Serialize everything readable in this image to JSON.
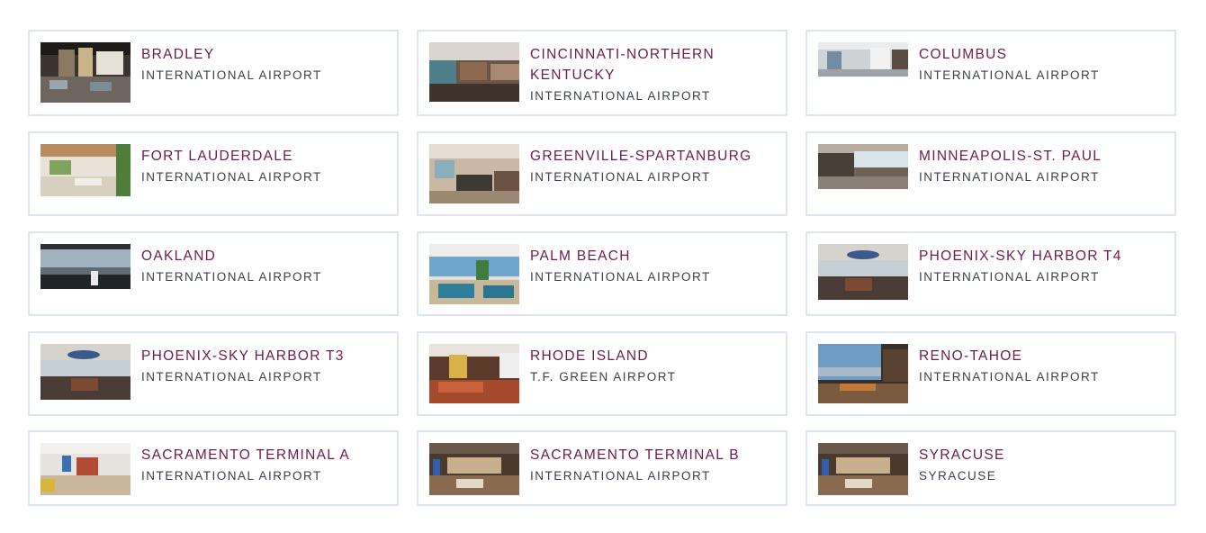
{
  "lounges": [
    {
      "name": "BRADLEY",
      "subtitle": "INTERNATIONAL AIRPORT",
      "photo": "lounge-photo"
    },
    {
      "name": "CINCINNATI-NORTHERN KENTUCKY",
      "subtitle": "INTERNATIONAL AIRPORT",
      "photo": "lounge-photo"
    },
    {
      "name": "COLUMBUS",
      "subtitle": "INTERNATIONAL AIRPORT",
      "photo": "lounge-photo"
    },
    {
      "name": "FORT LAUDERDALE",
      "subtitle": "INTERNATIONAL AIRPORT",
      "photo": "lounge-photo"
    },
    {
      "name": "GREENVILLE-SPARTANBURG",
      "subtitle": "INTERNATIONAL AIRPORT",
      "photo": "lounge-photo"
    },
    {
      "name": "MINNEAPOLIS-ST. PAUL",
      "subtitle": "INTERNATIONAL AIRPORT",
      "photo": "lounge-photo"
    },
    {
      "name": "OAKLAND",
      "subtitle": "INTERNATIONAL AIRPORT",
      "photo": "lounge-photo"
    },
    {
      "name": "PALM BEACH",
      "subtitle": "INTERNATIONAL AIRPORT",
      "photo": "lounge-photo"
    },
    {
      "name": "PHOENIX-SKY HARBOR T4",
      "subtitle": "INTERNATIONAL AIRPORT",
      "photo": "lounge-photo"
    },
    {
      "name": "PHOENIX-SKY HARBOR T3",
      "subtitle": "INTERNATIONAL AIRPORT",
      "photo": "lounge-photo"
    },
    {
      "name": "RHODE ISLAND",
      "subtitle": "T.F. GREEN AIRPORT",
      "photo": "lounge-photo"
    },
    {
      "name": "RENO-TAHOE",
      "subtitle": "INTERNATIONAL AIRPORT",
      "photo": "lounge-photo"
    },
    {
      "name": "SACRAMENTO TERMINAL A",
      "subtitle": "INTERNATIONAL AIRPORT",
      "photo": "lounge-photo"
    },
    {
      "name": "SACRAMENTO TERMINAL B",
      "subtitle": "INTERNATIONAL AIRPORT",
      "photo": "lounge-photo"
    },
    {
      "name": "SYRACUSE",
      "subtitle": "SYRACUSE",
      "photo": "lounge-photo"
    }
  ],
  "colors": {
    "title": "#6d1a4f",
    "subtitle": "#3a3f4a",
    "border": "#dde6ee"
  }
}
